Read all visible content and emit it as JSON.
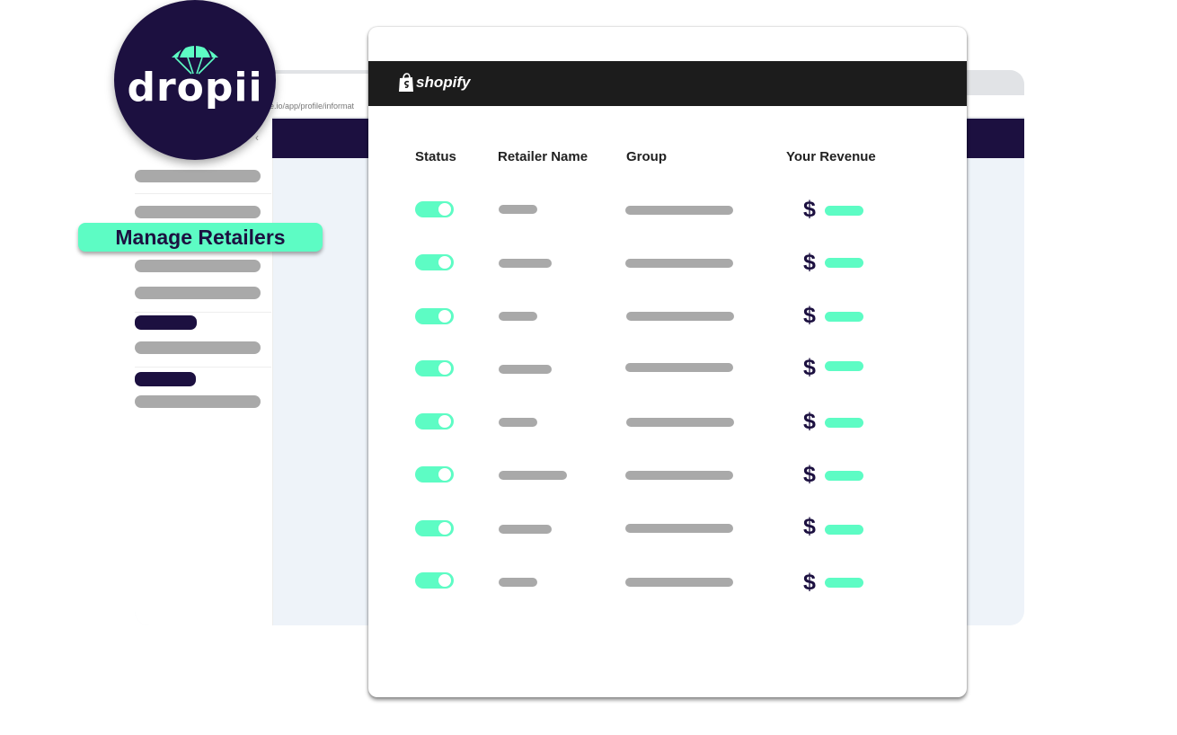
{
  "app": {
    "logo_text": "dropii"
  },
  "browser": {
    "tab_close": "×",
    "tab_new": "+",
    "url_fragment": "e.io/app/profile/informat",
    "sidebar_collapse": "‹"
  },
  "shopify": {
    "brand": "shopify"
  },
  "callout": {
    "label": "Manage Retailers"
  },
  "table": {
    "headers": {
      "status": "Status",
      "retailer_name": "Retailer Name",
      "group": "Group",
      "your_revenue": "Your Revenue"
    },
    "currency": "$",
    "rows": [
      {
        "status": "on"
      },
      {
        "status": "on"
      },
      {
        "status": "on"
      },
      {
        "status": "on"
      },
      {
        "status": "on"
      },
      {
        "status": "on"
      },
      {
        "status": "on"
      },
      {
        "status": "on"
      }
    ]
  },
  "colors": {
    "navy": "#1c1040",
    "accent": "#5dfcc4",
    "skeleton": "#a9a9a9",
    "shopify_bar": "#1c1c1c"
  },
  "icons": {
    "logo": "parachute-icon",
    "shopify": "shopping-bag-icon",
    "toggle": "toggle-switch"
  }
}
